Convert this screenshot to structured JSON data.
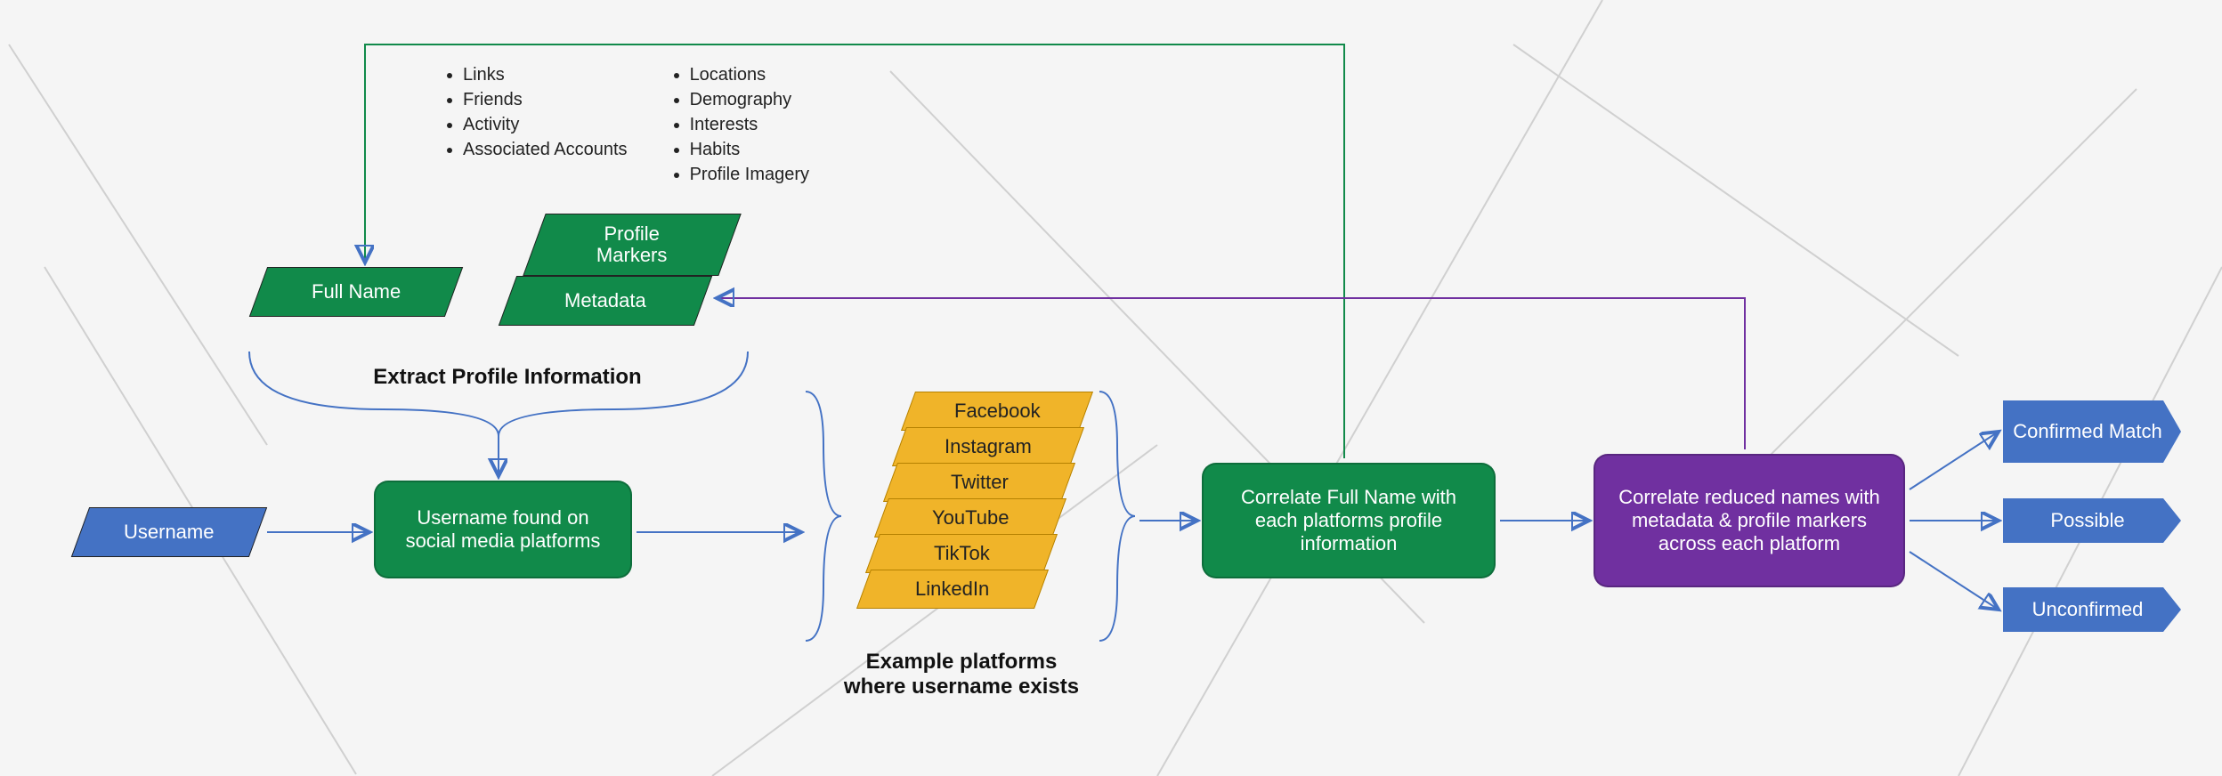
{
  "colors": {
    "blue": "#4472c4",
    "green": "#118a4a",
    "orange": "#f0b429",
    "purple": "#7030a0"
  },
  "input": {
    "username": "Username"
  },
  "extract": {
    "full_name": "Full Name",
    "metadata": "Metadata",
    "profile_markers": "Profile\nMarkers",
    "caption": "Extract Profile Information",
    "markers_col1": [
      "Links",
      "Friends",
      "Activity",
      "Associated Accounts"
    ],
    "markers_col2": [
      "Locations",
      "Demography",
      "Interests",
      "Habits",
      "Profile Imagery"
    ]
  },
  "step_found": "Username found on social media platforms",
  "platforms": {
    "caption": "Example platforms where username exists",
    "list": [
      "Facebook",
      "Instagram",
      "Twitter",
      "YouTube",
      "TikTok",
      "LinkedIn"
    ]
  },
  "step_correlate_name": "Correlate Full Name with each platforms profile information",
  "step_correlate_meta": "Correlate reduced names with metadata & profile markers across each platform",
  "outputs": {
    "confirmed": "Confirmed Match",
    "possible": "Possible",
    "unconfirmed": "Unconfirmed"
  }
}
